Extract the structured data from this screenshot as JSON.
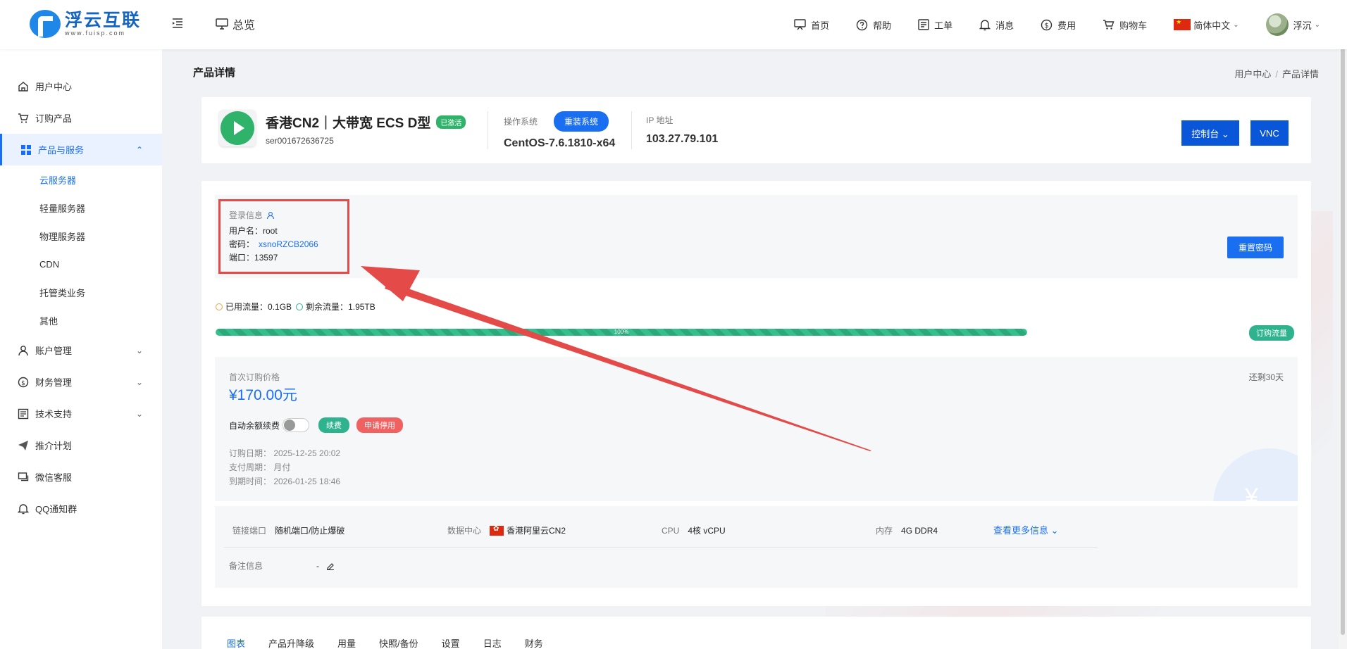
{
  "logo": {
    "cn": "浮云互联",
    "en": "www.fuisp.com"
  },
  "topbar": {
    "overview": "总览",
    "nav": [
      {
        "label": "首页"
      },
      {
        "label": "帮助"
      },
      {
        "label": "工单"
      },
      {
        "label": "消息"
      },
      {
        "label": "费用"
      },
      {
        "label": "购物车"
      }
    ],
    "language": "简体中文",
    "username": "浮沉"
  },
  "sidebar": {
    "items": [
      {
        "label": "用户中心"
      },
      {
        "label": "订购产品"
      },
      {
        "label": "产品与服务"
      },
      {
        "label": "账户管理"
      },
      {
        "label": "财务管理"
      },
      {
        "label": "技术支持"
      },
      {
        "label": "推介计划"
      },
      {
        "label": "微信客服"
      },
      {
        "label": "QQ通知群"
      }
    ],
    "subitems": [
      {
        "label": "云服务器"
      },
      {
        "label": "轻量服务器"
      },
      {
        "label": "物理服务器"
      },
      {
        "label": "CDN"
      },
      {
        "label": "托管类业务"
      },
      {
        "label": "其他"
      }
    ]
  },
  "page": {
    "title": "产品详情",
    "breadcrumb": [
      "用户中心",
      "产品详情"
    ],
    "breadcrumb_sep": "/"
  },
  "product": {
    "name": "香港CN2｜大带宽 ECS D型",
    "status": "已激活",
    "id": "ser001672636725",
    "os_label": "操作系统",
    "reinstall_label": "重装系统",
    "os_value": "CentOS-7.6.1810-x64",
    "ip_label": "IP 地址",
    "ip_value": "103.27.79.101",
    "console_label": "控制台",
    "vnc_label": "VNC"
  },
  "login": {
    "title": "登录信息",
    "username_label": "用户名：",
    "username": "root",
    "password_label": "密码：",
    "password": "xsnoRZCB2066",
    "port_label": "端口：",
    "port": "13597",
    "reset_label": "重置密码"
  },
  "traffic": {
    "used_label": "已用流量：",
    "used": "0.1GB",
    "remain_label": "剩余流量：",
    "remain": "1.95TB",
    "progress_text": "100%",
    "progress_fraction": 1.0,
    "buy_label": "订购流量"
  },
  "billing": {
    "price_label": "首次订购价格",
    "price": "¥170.00元",
    "remaining": "还剩30天",
    "auto_renew_label": "自动余额续费",
    "auto_renew_on": false,
    "renew_label": "续费",
    "suspend_label": "申请停用",
    "order_date": "订购日期：  2025-12-25 20:02",
    "pay_cycle": "支付周期：  月付",
    "expire": "到期时间：  2026-01-25 18:46"
  },
  "specs": {
    "port_label": "链接端口",
    "port_value": "随机端口/防止爆破",
    "dc_label": "数据中心",
    "dc_value": "香港阿里云CN2",
    "cpu_label": "CPU",
    "cpu_value": "4核 vCPU",
    "mem_label": "内存",
    "mem_value": "4G DDR4",
    "more_label": "查看更多信息",
    "remark_label": "备注信息",
    "remark_value": "-"
  },
  "tabs": [
    {
      "label": "图表"
    },
    {
      "label": "产品升降级"
    },
    {
      "label": "用量"
    },
    {
      "label": "快照/备份"
    },
    {
      "label": "设置"
    },
    {
      "label": "日志"
    },
    {
      "label": "财务"
    }
  ],
  "colors": {
    "primary": "#1a6ff0",
    "success": "#2fb36b",
    "danger": "#f06262",
    "annotation": "#e34a48"
  }
}
